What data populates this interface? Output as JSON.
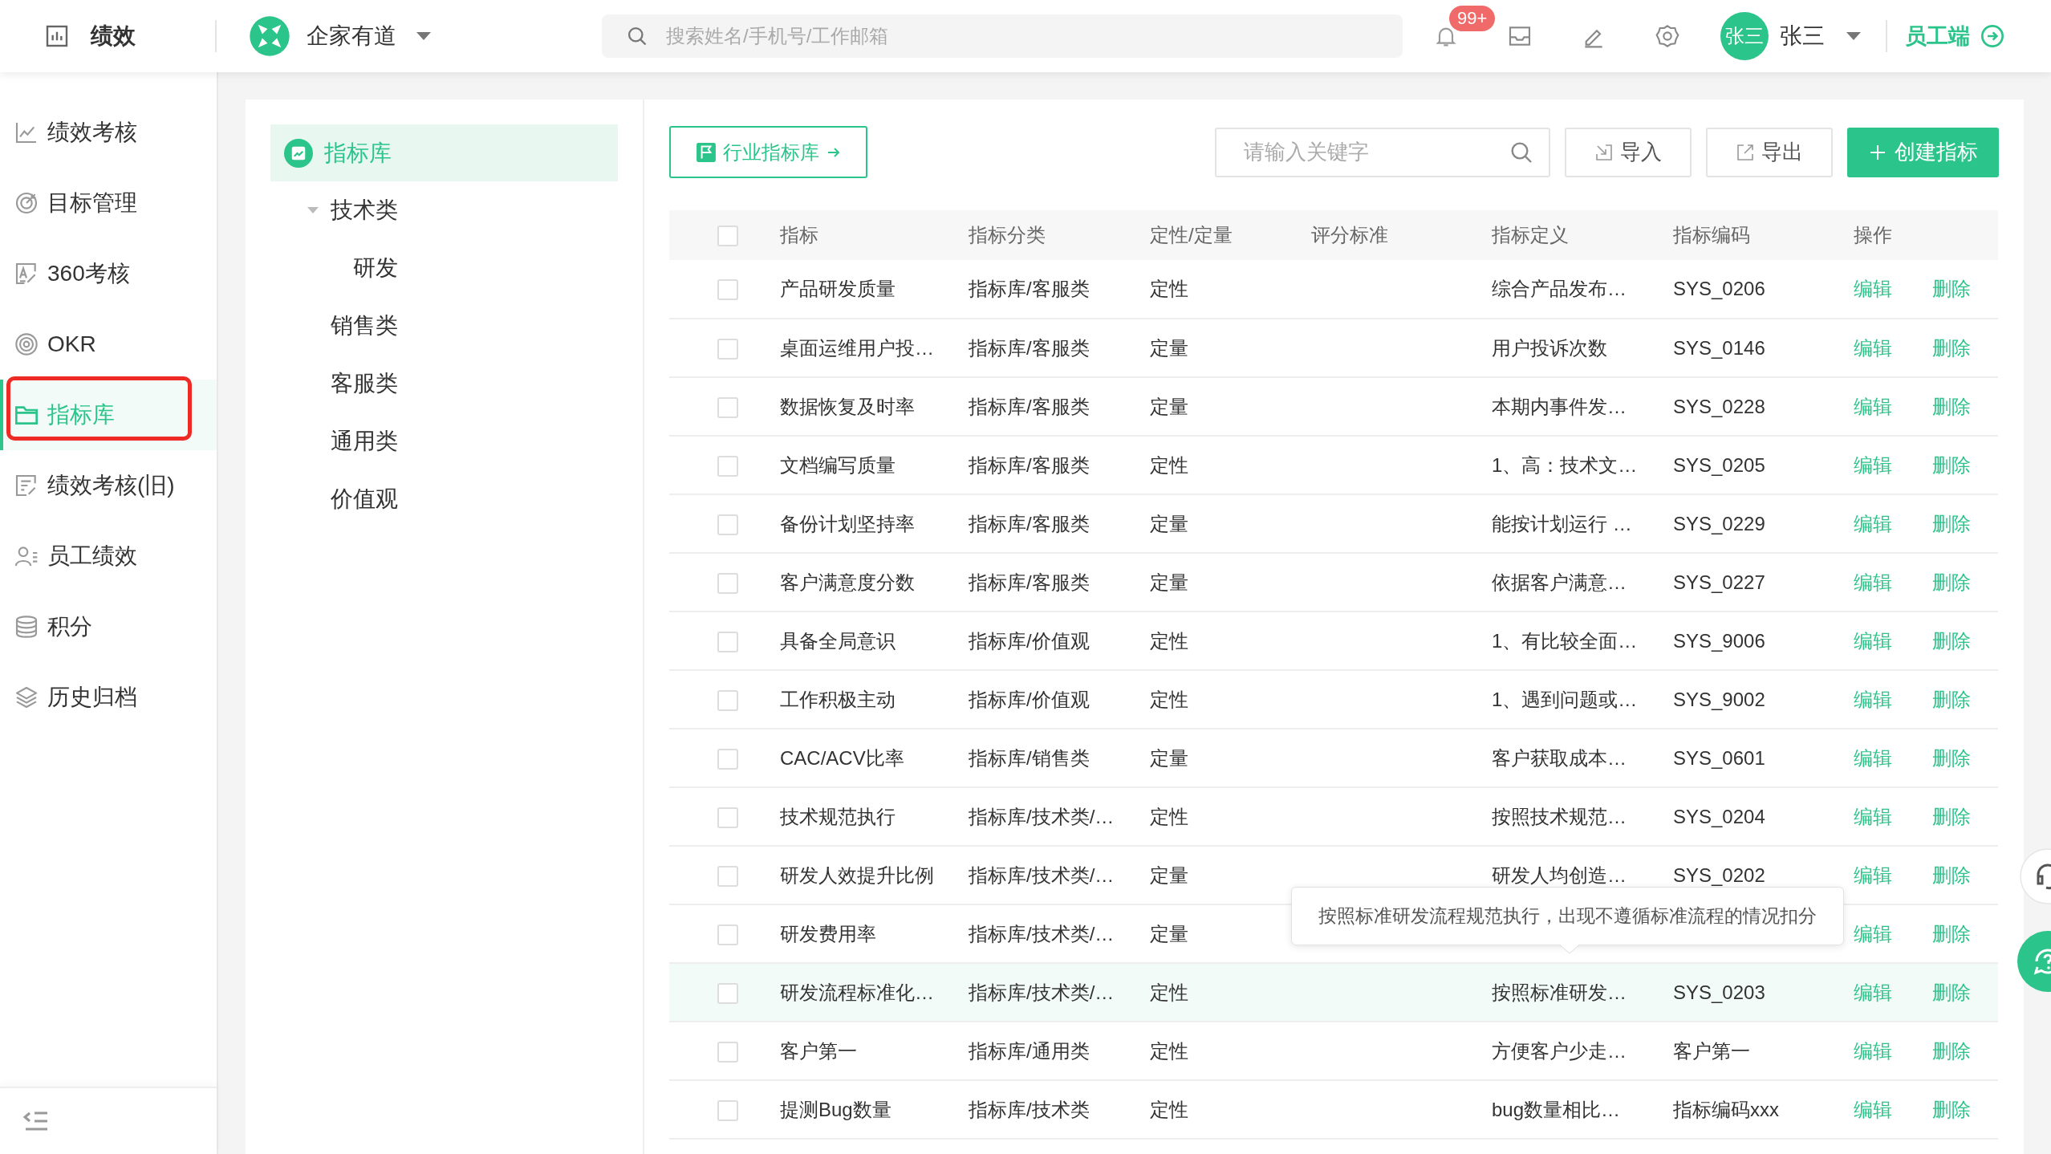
{
  "header": {
    "app_title": "绩效",
    "company": "企家有道",
    "search_placeholder": "搜索姓名/手机号/工作邮箱",
    "notification_badge": "99+",
    "avatar_text": "张三",
    "user_name": "张三",
    "switch_link": "员工端"
  },
  "sidebar": {
    "items": [
      {
        "label": "绩效考核",
        "selected": false
      },
      {
        "label": "目标管理",
        "selected": false
      },
      {
        "label": "360考核",
        "selected": false
      },
      {
        "label": "OKR",
        "selected": false
      },
      {
        "label": "指标库",
        "selected": true
      },
      {
        "label": "绩效考核(旧)",
        "selected": false
      },
      {
        "label": "员工绩效",
        "selected": false
      },
      {
        "label": "积分",
        "selected": false
      },
      {
        "label": "历史归档",
        "selected": false
      }
    ]
  },
  "tree": {
    "items": [
      {
        "label": "指标库",
        "selected": true,
        "children": [
          {
            "label": "技术类",
            "selected": false,
            "expanded": true,
            "children": [
              {
                "label": "研发",
                "selected": false
              }
            ]
          },
          {
            "label": "销售类",
            "selected": false
          },
          {
            "label": "客服类",
            "selected": false
          },
          {
            "label": "通用类",
            "selected": false
          },
          {
            "label": "价值观",
            "selected": false
          }
        ]
      }
    ]
  },
  "toolbar": {
    "industry_button": "行业指标库",
    "search_placeholder": "请输入关键字",
    "import_button": "导入",
    "export_button": "导出",
    "create_button": "创建指标"
  },
  "table": {
    "columns": [
      "指标",
      "指标分类",
      "定性/定量",
      "评分标准",
      "指标定义",
      "指标编码",
      "操作"
    ],
    "header_checked": false,
    "rows": [
      {
        "name": "产品研发质量",
        "category": "指标库/客服类",
        "type": "定性",
        "definition": "综合产品发布…",
        "code": "SYS_0206",
        "actions": [
          "编辑",
          "删除"
        ],
        "checked": false,
        "hovered": false
      },
      {
        "name": "桌面运维用户投…",
        "category": "指标库/客服类",
        "type": "定量",
        "definition": "用户投诉次数",
        "code": "SYS_0146",
        "actions": [
          "编辑",
          "删除"
        ],
        "checked": false,
        "hovered": false
      },
      {
        "name": "数据恢复及时率",
        "category": "指标库/客服类",
        "type": "定量",
        "definition": "本期内事件发…",
        "code": "SYS_0228",
        "actions": [
          "编辑",
          "删除"
        ],
        "checked": false,
        "hovered": false
      },
      {
        "name": "文档编写质量",
        "category": "指标库/客服类",
        "type": "定性",
        "definition": "1、高：技术文…",
        "code": "SYS_0205",
        "actions": [
          "编辑",
          "删除"
        ],
        "checked": false,
        "hovered": false
      },
      {
        "name": "备份计划坚持率",
        "category": "指标库/客服类",
        "type": "定量",
        "definition": "能按计划运行 …",
        "code": "SYS_0229",
        "actions": [
          "编辑",
          "删除"
        ],
        "checked": false,
        "hovered": false
      },
      {
        "name": "客户满意度分数",
        "category": "指标库/客服类",
        "type": "定量",
        "definition": "依据客户满意…",
        "code": "SYS_0227",
        "actions": [
          "编辑",
          "删除"
        ],
        "checked": false,
        "hovered": false
      },
      {
        "name": "具备全局意识",
        "category": "指标库/价值观",
        "type": "定性",
        "definition": "1、有比较全面…",
        "code": "SYS_9006",
        "actions": [
          "编辑",
          "删除"
        ],
        "checked": false,
        "hovered": false
      },
      {
        "name": "工作积极主动",
        "category": "指标库/价值观",
        "type": "定性",
        "definition": "1、遇到问题或…",
        "code": "SYS_9002",
        "actions": [
          "编辑",
          "删除"
        ],
        "checked": false,
        "hovered": false
      },
      {
        "name": "CAC/ACV比率",
        "category": "指标库/销售类",
        "type": "定量",
        "definition": "客户获取成本…",
        "code": "SYS_0601",
        "actions": [
          "编辑",
          "删除"
        ],
        "checked": false,
        "hovered": false
      },
      {
        "name": "技术规范执行",
        "category": "指标库/技术类/…",
        "type": "定性",
        "definition": "按照技术规范…",
        "code": "SYS_0204",
        "actions": [
          "编辑",
          "删除"
        ],
        "checked": false,
        "hovered": false
      },
      {
        "name": "研发人效提升比例",
        "category": "指标库/技术类/…",
        "type": "定量",
        "definition": "研发人均创造…",
        "code": "SYS_0202",
        "actions": [
          "编辑",
          "删除"
        ],
        "checked": false,
        "hovered": false
      },
      {
        "name": "研发费用率",
        "category": "指标库/技术类/…",
        "type": "定量",
        "actions": [
          "编辑",
          "删除"
        ],
        "checked": false,
        "hovered": false
      },
      {
        "name": "研发流程标准化…",
        "category": "指标库/技术类/…",
        "type": "定性",
        "definition": "按照标准研发…",
        "code": "SYS_0203",
        "actions": [
          "编辑",
          "删除"
        ],
        "checked": false,
        "hovered": true
      },
      {
        "name": "客户第一",
        "category": "指标库/通用类",
        "type": "定性",
        "definition": "方便客户少走…",
        "code": "客户第一",
        "actions": [
          "编辑",
          "删除"
        ],
        "checked": false,
        "hovered": false
      },
      {
        "name": "提测Bug数量",
        "category": "指标库/技术类",
        "type": "定性",
        "definition": "bug数量相比…",
        "code": "指标编码xxx",
        "actions": [
          "编辑",
          "删除"
        ],
        "checked": false,
        "hovered": false
      }
    ]
  },
  "tooltip": {
    "text": "按照标准研发流程规范执行，出现不遵循标准流程的情况扣分"
  }
}
